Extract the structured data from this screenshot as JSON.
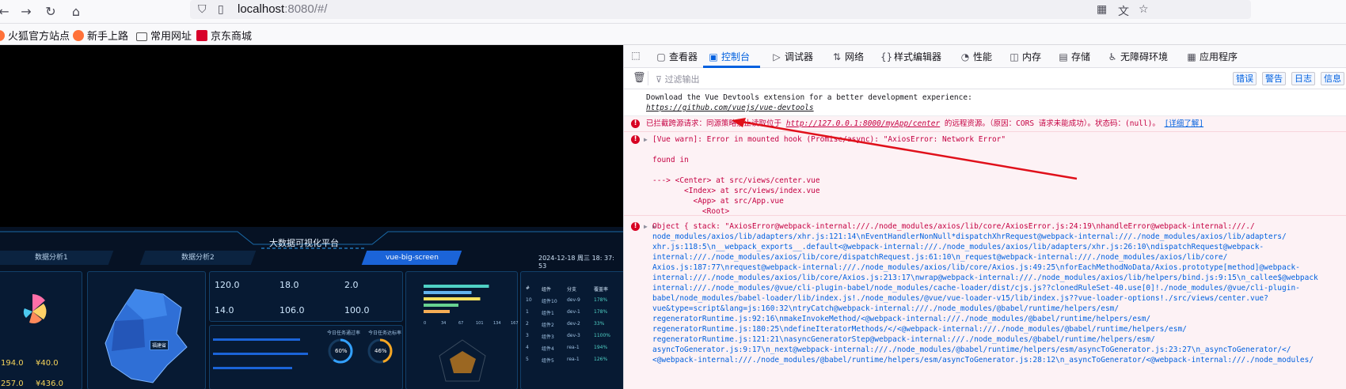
{
  "browser": {
    "url_host": "localhost",
    "url_rest": ":8080/#/"
  },
  "bookmarks": [
    {
      "label": "火狐官方站点"
    },
    {
      "label": "新手上路"
    },
    {
      "label": "常用网址"
    },
    {
      "label": "京东商城"
    }
  ],
  "devtools": {
    "tabs": [
      "查看器",
      "控制台",
      "调试器",
      "网络",
      "样式编辑器",
      "性能",
      "内存",
      "存储",
      "无障碍环境",
      "应用程序"
    ],
    "filter_placeholder": "过滤输出",
    "filter_buttons": [
      "错误",
      "警告",
      "日志",
      "信息"
    ],
    "messages": {
      "m1_line1": "Download the Vue Devtools extension for a better development experience:",
      "m1_link": "https://github.com/vuejs/vue-devtools",
      "m2_pre": "已拦截跨源请求：同源策略禁止读取位于 ",
      "m2_link": "http://127.0.0.1:8000/myApp/center",
      "m2_post": " 的远程资源。（原因：CORS 请求未能成功）。状态码：(null)。",
      "m2_more": "[详细了解]",
      "m3_line1": "[Vue warn]: Error in mounted hook (Promise/async): \"AxiosError: Network Error\"",
      "m3_line2": "found in",
      "m3_line3": "---> <Center> at src/views/center.vue",
      "m3_line4": "       <Index> at src/views/index.vue",
      "m3_line5": "         <App> at src/App.vue",
      "m3_line6": "           <Root>",
      "m4_lines": [
        "Object { stack: \"AxiosError@webpack-internal:///./node_modules/axios/lib/core/AxiosError.js:24:19\\nhandleError@webpack-internal:///./",
        "node_modules/axios/lib/adapters/xhr.js:121:14\\nEventHandlerNonNull*dispatchXhrRequest@webpack-internal:///./node_modules/axios/lib/adapters/",
        "xhr.js:118:5\\n__webpack_exports__.default<@webpack-internal:///./node_modules/axios/lib/adapters/xhr.js:26:10\\ndispatchRequest@webpack-",
        "internal:///./node_modules/axios/lib/core/dispatchRequest.js:61:10\\n_request@webpack-internal:///./node_modules/axios/lib/core/",
        "Axios.js:187:77\\nrequest@webpack-internal:///./node_modules/axios/lib/core/Axios.js:49:25\\nforEachMethodNoData/Axios.prototype[method]@webpack-",
        "internal:///./node_modules/axios/lib/core/Axios.js:213:17\\nwrap@webpack-internal:///./node_modules/axios/lib/helpers/bind.js:9:15\\n_callee$@webpack",
        "internal:///./node_modules/@vue/cli-plugin-babel/node_modules/cache-loader/dist/cjs.js??clonedRuleSet-40.use[0]!./node_modules/@vue/cli-plugin-",
        "babel/node_modules/babel-loader/lib/index.js!./node_modules/@vue/vue-loader-v15/lib/index.js??vue-loader-options!./src/views/center.vue?",
        "vue&type=script&lang=js:160:32\\ntryCatch@webpack-internal:///./node_modules/@babel/runtime/helpers/esm/",
        "regeneratorRuntime.js:92:16\\nmakeInvokeMethod/<@webpack-internal:///./node_modules/@babel/runtime/helpers/esm/",
        "regeneratorRuntime.js:180:25\\ndefineIteratorMethods/</<@webpack-internal:///./node_modules/@babel/runtime/helpers/esm/",
        "regeneratorRuntime.js:121:21\\nasyncGeneratorStep@webpack-internal:///./node_modules/@babel/runtime/helpers/esm/",
        "asyncToGenerator.js:9:17\\n_next@webpack-internal:///./node_modules/@babel/runtime/helpers/esm/asyncToGenerator.js:23:27\\n_asyncToGenerator/</",
        "<@webpack-internal:///./node_modules/@babel/runtime/helpers/esm/asyncToGenerator.js:28:12\\n_asyncToGenerator/<@webpack-internal:///./node_modules/"
      ]
    }
  },
  "dashboard": {
    "title": "大数据可视化平台",
    "tabs": [
      "数据分析1",
      "数据分析2",
      "vue-big-screen"
    ],
    "datetime": "2024-12-18 周三 18: 37: 53",
    "stats": [
      "120.0",
      "18.0",
      "2.0",
      "14.0",
      "106.0",
      "100.0"
    ],
    "left_stats": [
      "194.0",
      "¥40.0",
      "257.0",
      "¥436.0"
    ],
    "labels": [
      "今日任务通过率",
      "今日任务达标率"
    ],
    "rings": [
      "60%",
      "46%"
    ],
    "table_head": [
      "#",
      "组件",
      "分支",
      "覆盖率"
    ],
    "table_rows": [
      [
        "10",
        "组件10",
        "dev-9",
        "178%"
      ],
      [
        "1",
        "组件1",
        "dev-1",
        "178%"
      ],
      [
        "2",
        "组件2",
        "dev-2",
        "33%"
      ],
      [
        "3",
        "组件3",
        "dev-3",
        "1100%"
      ],
      [
        "4",
        "组件4",
        "rea-1",
        "194%"
      ],
      [
        "5",
        "组件5",
        "rea-1",
        "126%"
      ]
    ],
    "bar_ticks": [
      "0",
      "34",
      "67",
      "101",
      "134",
      "167"
    ],
    "bars": [
      0.75,
      0.55,
      0.65,
      0.4,
      0.3
    ],
    "map_label": "福建省"
  }
}
